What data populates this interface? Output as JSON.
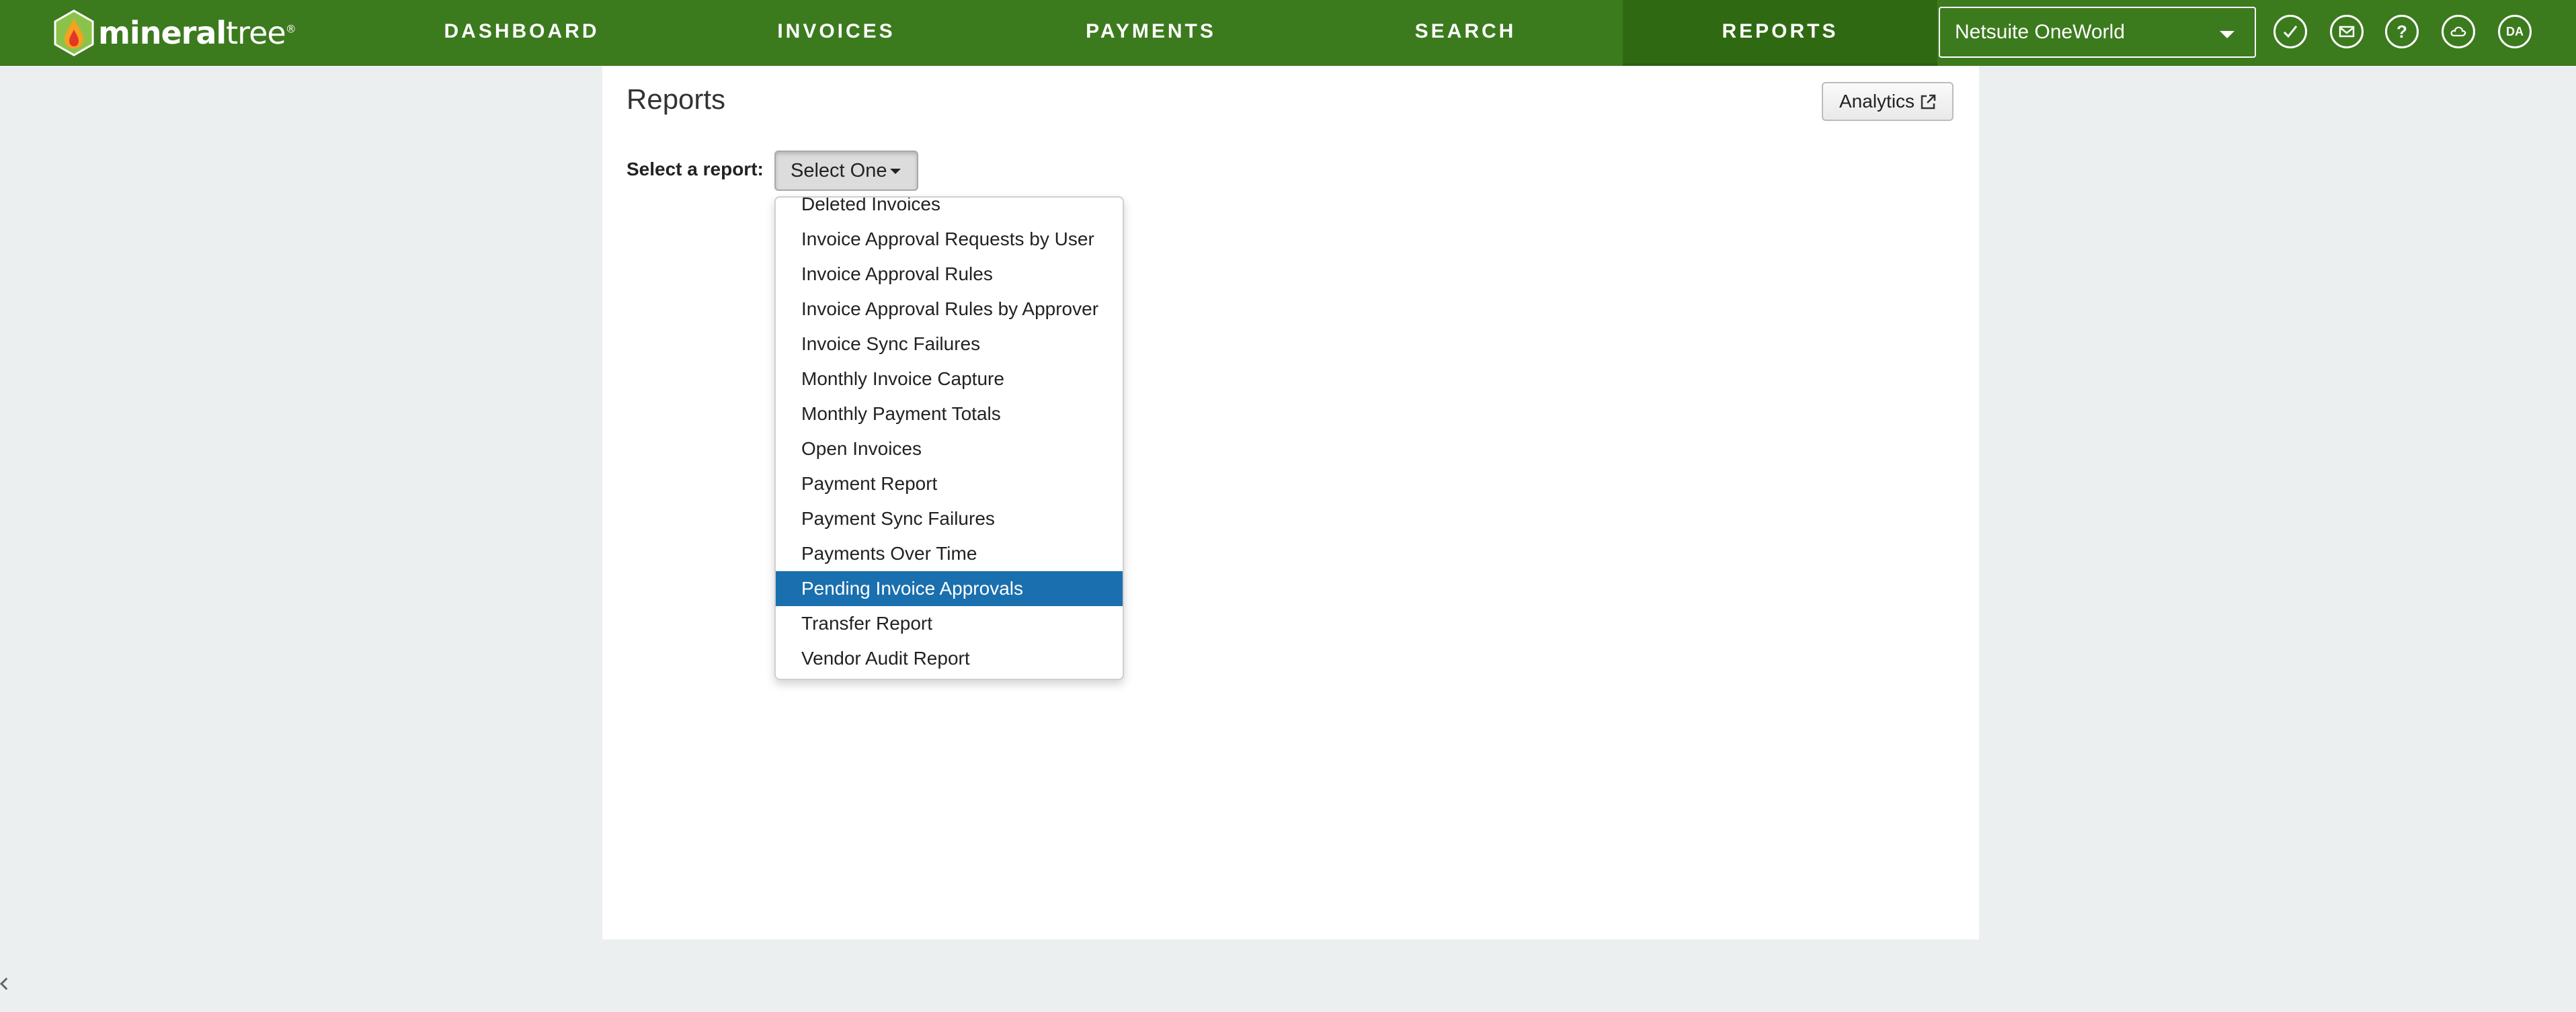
{
  "brand": {
    "name_bold": "mineral",
    "name_light": "tree",
    "registered": "®",
    "color": "#3c7a1e"
  },
  "nav": {
    "items": [
      {
        "label": "DASHBOARD",
        "active": false
      },
      {
        "label": "INVOICES",
        "active": false
      },
      {
        "label": "PAYMENTS",
        "active": false
      },
      {
        "label": "SEARCH",
        "active": false
      },
      {
        "label": "REPORTS",
        "active": true
      }
    ],
    "org_select": {
      "value": "Netsuite OneWorld"
    },
    "icons": [
      {
        "name": "check-icon"
      },
      {
        "name": "mail-icon"
      },
      {
        "name": "help-icon",
        "glyph": "?"
      },
      {
        "name": "cloud-icon"
      },
      {
        "name": "avatar",
        "initials": "DA"
      }
    ]
  },
  "page": {
    "title": "Reports",
    "analytics_label": "Analytics",
    "select_label": "Select a report:",
    "select_value": "Select One"
  },
  "dropdown": {
    "options": [
      "Deleted Invoices",
      "Invoice Approval Requests by User",
      "Invoice Approval Rules",
      "Invoice Approval Rules by Approver",
      "Invoice Sync Failures",
      "Monthly Invoice Capture",
      "Monthly Payment Totals",
      "Open Invoices",
      "Payment Report",
      "Payment Sync Failures",
      "Payments Over Time",
      "Pending Invoice Approvals",
      "Transfer Report",
      "Vendor Audit Report"
    ],
    "highlighted": "Pending Invoice Approvals",
    "highlight_color": "#1a6fae"
  }
}
